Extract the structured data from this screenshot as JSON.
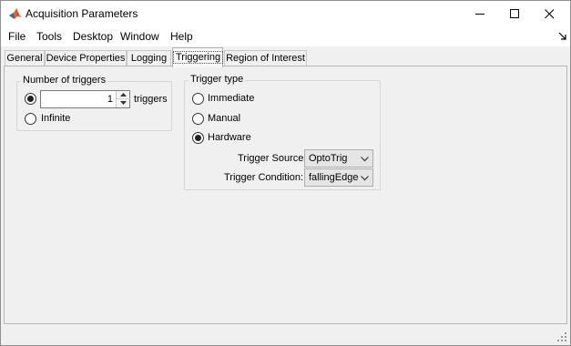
{
  "window": {
    "title": "Acquisition Parameters",
    "accent": "#0072bd"
  },
  "menu": [
    "File",
    "Tools",
    "Desktop",
    "Window",
    "Help"
  ],
  "tabs": [
    {
      "label": "General"
    },
    {
      "label": "Device Properties"
    },
    {
      "label": "Logging"
    },
    {
      "label": "Triggering",
      "selected": true
    },
    {
      "label": "Region of Interest"
    }
  ],
  "number_of_triggers": {
    "legend": "Number of triggers",
    "count_value": "1",
    "count_unit": "triggers",
    "infinite_label": "Infinite",
    "selected": "count"
  },
  "trigger_type": {
    "legend": "Trigger type",
    "options": [
      "Immediate",
      "Manual",
      "Hardware"
    ],
    "selected": "Hardware",
    "source_label": "Trigger Source:",
    "source_value": "OptoTrig",
    "condition_label": "Trigger Condition:",
    "condition_value": "fallingEdge"
  },
  "icons": {
    "app": "matlab-logo-icon",
    "minimize": "minimize-icon",
    "maximize": "maximize-icon",
    "close": "close-icon",
    "dock": "dock-arrow-icon",
    "spin_up": "spin-up-icon",
    "spin_down": "spin-down-icon",
    "dropdown": "chevron-down-icon",
    "grip": "resize-grip-icon"
  }
}
